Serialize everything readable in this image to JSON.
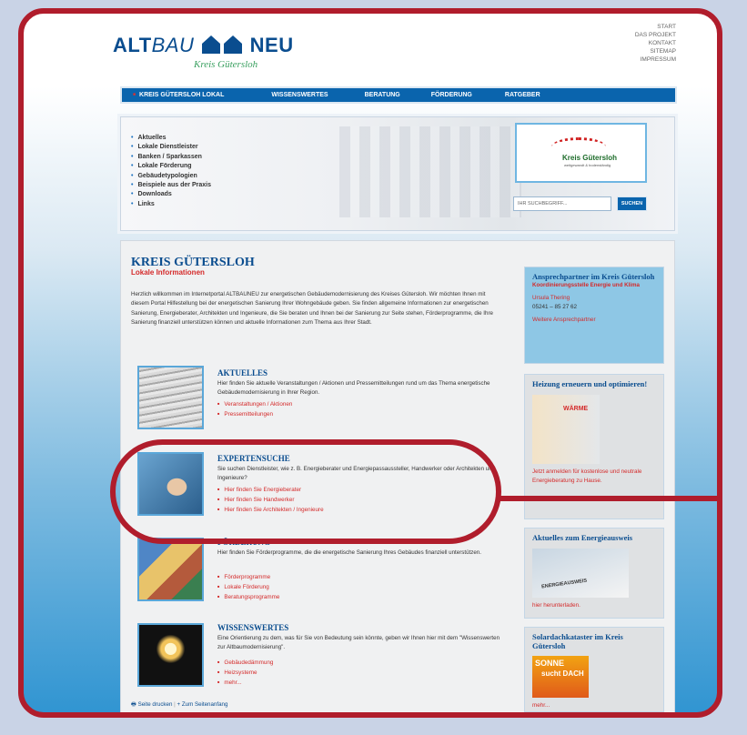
{
  "header": {
    "logo_alt": "ALT",
    "logo_bau": "BAU",
    "logo_neu": "NEU",
    "logo_sub": "Kreis Gütersloh",
    "top_links": [
      "START",
      "DAS PROJEKT",
      "KONTAKT",
      "SITEMAP",
      "IMPRESSUM"
    ]
  },
  "mainnav": {
    "items": [
      "KREIS GÜTERSLOH LOKAL",
      "WISSENSWERTES",
      "BERATUNG",
      "FÖRDERUNG",
      "RATGEBER"
    ]
  },
  "sidebar": {
    "items": [
      "Aktuelles",
      "Lokale Dienstleister",
      "Banken / Sparkassen",
      "Lokale Förderung",
      "Gebäudetypologien",
      "Beispiele aus der Praxis",
      "Downloads",
      "Links"
    ]
  },
  "kreis_logo": {
    "name": "Kreis Gütersloh",
    "tagline": "weitgewandt & bodenständig"
  },
  "search": {
    "placeholder": "IHR SUCHBEGRIFF...",
    "button": "SUCHEN"
  },
  "main": {
    "title": "KREIS GÜTERSLOH",
    "subtitle": "Lokale Informationen",
    "intro": "Herzlich willkommen im Internetportal ALTBAUNEU zur energetischen Gebäudemodernisierung des Kreises Gütersloh. Wir möchten Ihnen mit diesem Portal Hilfestellung bei der energetischen Sanierung Ihrer Wohngebäude geben. Sie finden allgemeine Informationen zur energetischen Sanierung, Energieberater, Architekten und Ingenieure, die Sie beraten und Ihnen bei der Sanierung zur Seite stehen, Förderprogramme, die Ihre Sanierung finanziell unterstützen können und aktuelle Informationen zum Thema aus Ihrer Stadt.",
    "sections": [
      {
        "title": "AKTUELLES",
        "text": "Hier finden Sie aktuelle Veranstaltungen / Aktionen und Pressemitteilungen rund um das Thema energetische Gebäudemodernisierung in Ihrer Region.",
        "links": [
          "Veranstaltungen / Aktionen",
          "Pressemitteilungen"
        ]
      },
      {
        "title": "EXPERTENSUCHE",
        "text": "Sie suchen Dienstleister, wie z. B. Energieberater und Energiepassaussteller, Handwerker oder Architekten und Ingenieure?",
        "links": [
          "Hier finden Sie Energieberater",
          "Hier finden Sie Handwerker",
          "Hier finden Sie Architekten / Ingenieure"
        ]
      },
      {
        "title": "FÖRDERUNG",
        "text": "Hier finden Sie Förderprogramme, die die energetische Sanierung Ihres Gebäudes finanziell unterstützen.",
        "links": [
          "Förderprogramme",
          "Lokale Förderung",
          "Beratungsprogramme"
        ]
      },
      {
        "title": "WISSENSWERTES",
        "text": "Eine Orientierung zu dem, was für Sie von Bedeutung sein könnte, geben wir Ihnen hier mit dem \"Wissenswerten zur Altbaumodernisierung\".",
        "links": [
          "Gebäudedämmung",
          "Heizsysteme",
          "mehr..."
        ]
      }
    ],
    "print_link": "Seite drucken",
    "top_link": "Zum Seitenanfang"
  },
  "right": {
    "contact": {
      "title": "Ansprechpartner im Kreis Gütersloh",
      "org": "Koordinierungsstelle Energie und Klima",
      "name": "Ursula Thering",
      "phone": "05241 – 85 27 62",
      "more": "Weitere Ansprechpartner"
    },
    "heizung": {
      "title": "Heizung erneuern und optimieren!",
      "img_text": "WÄRME",
      "link": "Jetzt anmelden für kostenlose und neutrale Energieberatung zu Hause."
    },
    "energieausweis": {
      "title": "Aktuelles zum Energieausweis",
      "img_text": "ENERGIEAUSWEIS",
      "link": "hier herunterladen."
    },
    "solar": {
      "title": "Solardachkataster im Kreis Gütersloh",
      "img_text1": "SONNE",
      "img_text2": "sucht DACH",
      "link": "mehr..."
    }
  }
}
